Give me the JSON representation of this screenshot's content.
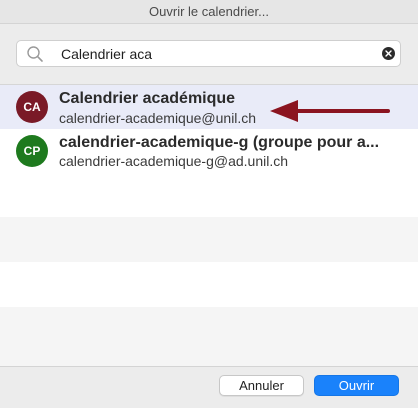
{
  "window": {
    "title": "Ouvrir le calendrier..."
  },
  "search": {
    "value": "Calendrier aca",
    "placeholder": ""
  },
  "results": [
    {
      "initials": "CA",
      "name": "Calendrier académique",
      "email": "calendrier-academique@unil.ch",
      "avatar_color": "#7a1a27"
    },
    {
      "initials": "CP",
      "name": "calendrier-academique-g (groupe pour a...",
      "email": "calendrier-academique-g@ad.unil.ch",
      "avatar_color": "#1e7a1e"
    }
  ],
  "annotation": {
    "arrow_color": "#8b1420"
  },
  "footer": {
    "cancel_label": "Annuler",
    "open_label": "Ouvrir"
  },
  "colors": {
    "accent": "#1a82fb",
    "selected_row": "#e9ebf8"
  }
}
